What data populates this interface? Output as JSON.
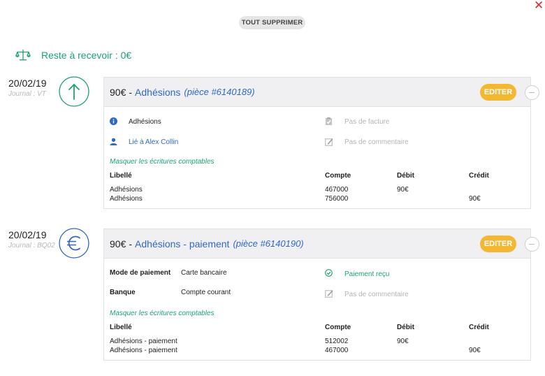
{
  "header": {
    "close_icon": "close-x-icon",
    "clear_all_label": "TOUT SUPPRIMER",
    "balance_icon": "scale-balance-icon",
    "balance_label": "Reste à recevoir : 0€"
  },
  "entries": [
    {
      "date": "20/02/19",
      "journal": "Journal : VT",
      "icon": "arrow-up-icon",
      "icon_color": "#1aa36d",
      "amount": "90€",
      "separator": "-",
      "title": "Adhésions",
      "piece": "(pièce #6140189)",
      "edit_label": "EDITER",
      "info_text": "Adhésions",
      "user_link": "Lié à Alex Collin",
      "invoice_status": "Pas de facture",
      "comment_status": "Pas de commentaire",
      "toggle_label": "Masquer les écritures comptables",
      "headers": {
        "label": "Libellé",
        "account": "Compte",
        "debit": "Débit",
        "credit": "Crédit"
      },
      "rows": [
        {
          "label": "Adhésions",
          "account": "467000",
          "debit": "90€",
          "credit": ""
        },
        {
          "label": "Adhésions",
          "account": "756000",
          "debit": "",
          "credit": "90€"
        }
      ]
    },
    {
      "date": "20/02/19",
      "journal": "Journal : BQ02",
      "icon": "euro-icon",
      "icon_color": "#2f68c8",
      "amount": "90€",
      "separator": "-",
      "title": "Adhésions - paiement",
      "piece": "(pièce #6140190)",
      "edit_label": "EDITER",
      "payment_mode_label": "Mode de paiement",
      "payment_mode_value": "Carte bancaire",
      "bank_label": "Banque",
      "bank_value": "Compte courant",
      "payment_status": "Paiement reçu",
      "comment_status": "Pas de commentaire",
      "toggle_label": "Masquer les écritures comptables",
      "headers": {
        "label": "Libellé",
        "account": "Compte",
        "debit": "Débit",
        "credit": "Crédit"
      },
      "rows": [
        {
          "label": "Adhésions - paiement",
          "account": "512002",
          "debit": "90€",
          "credit": ""
        },
        {
          "label": "Adhésions - paiement",
          "account": "467000",
          "debit": "",
          "credit": "90€"
        }
      ]
    }
  ],
  "colors": {
    "accent_green": "#1aa36d",
    "link_blue": "#2f68c8",
    "edit_yellow": "#f4b731",
    "close_red": "#e3242b"
  }
}
